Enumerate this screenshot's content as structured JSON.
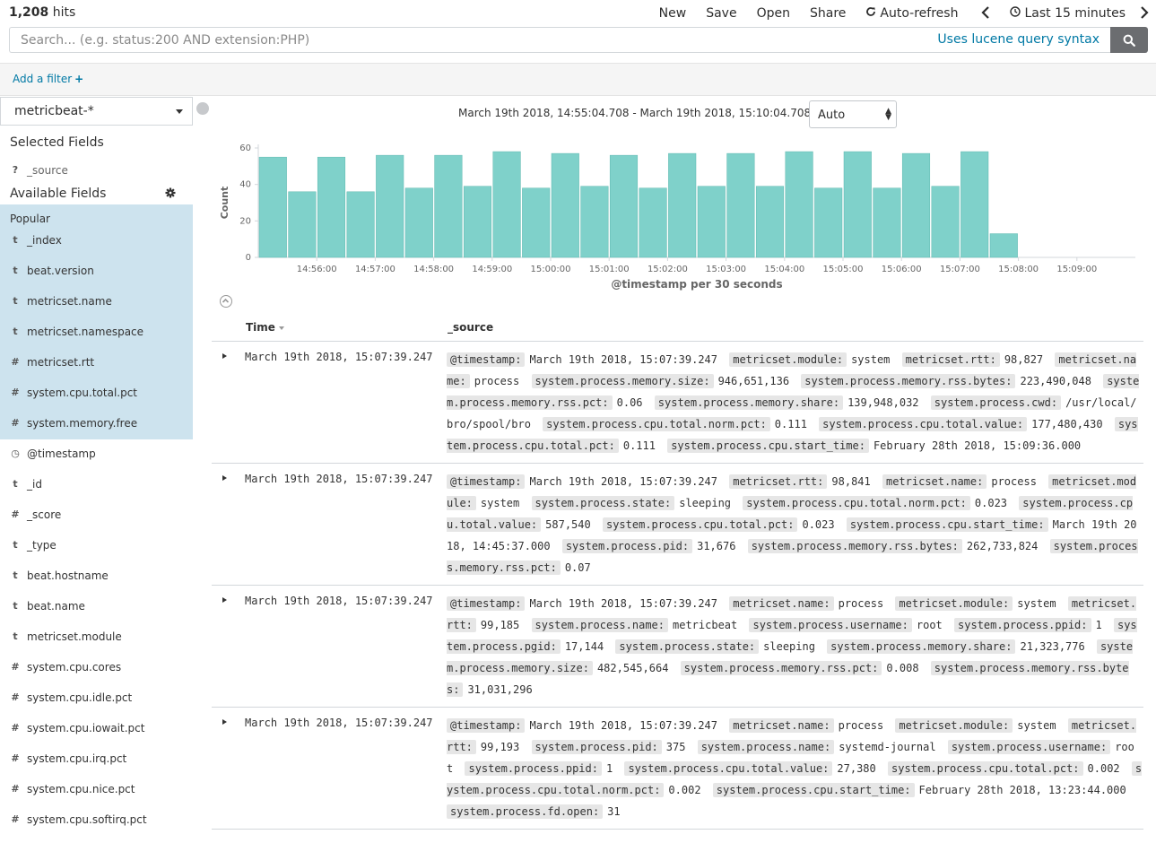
{
  "topbar": {
    "hits_count": "1,208",
    "hits_label": "hits",
    "nav": {
      "new": "New",
      "save": "Save",
      "open": "Open",
      "share": "Share",
      "auto_refresh": "Auto-refresh",
      "time_range": "Last 15 minutes"
    },
    "icons": {
      "auto_refresh": "refresh-icon",
      "time": "clock-icon",
      "prev": "chevron-left-icon",
      "next": "chevron-right-icon"
    }
  },
  "search": {
    "placeholder": "Search... (e.g. status:200 AND extension:PHP)",
    "syntax_link": "Uses lucene query syntax",
    "button_icon": "search-icon"
  },
  "filterbar": {
    "add_filter": "Add a filter",
    "add_filter_icon": "+"
  },
  "sidebar": {
    "index_pattern": "metricbeat-*",
    "selected_fields_title": "Selected Fields",
    "selected_fields": [
      {
        "type": "?",
        "name": "_source"
      }
    ],
    "available_fields_title": "Available Fields",
    "popular_label": "Popular",
    "popular_fields": [
      {
        "type": "t",
        "name": "_index"
      },
      {
        "type": "t",
        "name": "beat.version"
      },
      {
        "type": "t",
        "name": "metricset.name"
      },
      {
        "type": "t",
        "name": "metricset.namespace"
      },
      {
        "type": "#",
        "name": "metricset.rtt"
      },
      {
        "type": "#",
        "name": "system.cpu.total.pct"
      },
      {
        "type": "#",
        "name": "system.memory.free"
      }
    ],
    "other_fields": [
      {
        "type": "◷",
        "name": "@timestamp"
      },
      {
        "type": "t",
        "name": "_id"
      },
      {
        "type": "#",
        "name": "_score"
      },
      {
        "type": "t",
        "name": "_type"
      },
      {
        "type": "t",
        "name": "beat.hostname"
      },
      {
        "type": "t",
        "name": "beat.name"
      },
      {
        "type": "t",
        "name": "metricset.module"
      },
      {
        "type": "#",
        "name": "system.cpu.cores"
      },
      {
        "type": "#",
        "name": "system.cpu.idle.pct"
      },
      {
        "type": "#",
        "name": "system.cpu.iowait.pct"
      },
      {
        "type": "#",
        "name": "system.cpu.irq.pct"
      },
      {
        "type": "#",
        "name": "system.cpu.nice.pct"
      },
      {
        "type": "#",
        "name": "system.cpu.softirq.pct"
      }
    ]
  },
  "histogram": {
    "range_text": "March 19th 2018, 14:55:04.708 - March 19th 2018, 15:10:04.708 —",
    "interval": "Auto"
  },
  "chart_data": {
    "type": "bar",
    "ylabel": "Count",
    "xlabel": "@timestamp per 30 seconds",
    "ylim": [
      0,
      60
    ],
    "yticks": [
      0,
      20,
      40,
      60
    ],
    "grid": false,
    "x_start": "14:55:00",
    "bin_seconds": 30,
    "x_end": "15:10:00",
    "xtick_labels": [
      "14:56:00",
      "14:57:00",
      "14:58:00",
      "14:59:00",
      "15:00:00",
      "15:01:00",
      "15:02:00",
      "15:03:00",
      "15:04:00",
      "15:05:00",
      "15:06:00",
      "15:07:00",
      "15:08:00",
      "15:09:00"
    ],
    "values": [
      55,
      36,
      55,
      36,
      56,
      38,
      56,
      39,
      58,
      38,
      57,
      39,
      56,
      38,
      57,
      39,
      57,
      39,
      58,
      38,
      58,
      38,
      57,
      39,
      58,
      13
    ],
    "bar_color": "#7fd1ca"
  },
  "table": {
    "col_time": "Time",
    "col_source": "_source",
    "rows": [
      {
        "time": "March 19th 2018, 15:07:39.247",
        "fields": [
          [
            "@timestamp:",
            "March 19th 2018, 15:07:39.247"
          ],
          [
            "metricset.module:",
            "system"
          ],
          [
            "metricset.rtt:",
            "98,827"
          ],
          [
            "metricset.name:",
            "process"
          ],
          [
            "system.process.memory.size:",
            "946,651,136"
          ],
          [
            "system.process.memory.rss.bytes:",
            "223,490,048"
          ],
          [
            "system.process.memory.rss.pct:",
            "0.06"
          ],
          [
            "system.process.memory.share:",
            "139,948,032"
          ],
          [
            "system.process.cwd:",
            "/usr/local/bro/spool/bro"
          ],
          [
            "system.process.cpu.total.norm.pct:",
            "0.111"
          ],
          [
            "system.process.cpu.total.value:",
            "177,480,430"
          ],
          [
            "system.process.cpu.total.pct:",
            "0.111"
          ],
          [
            "system.process.cpu.start_time:",
            "February 28th 2018, 15:09:36.000"
          ]
        ]
      },
      {
        "time": "March 19th 2018, 15:07:39.247",
        "fields": [
          [
            "@timestamp:",
            "March 19th 2018, 15:07:39.247"
          ],
          [
            "metricset.rtt:",
            "98,841"
          ],
          [
            "metricset.name:",
            "process"
          ],
          [
            "metricset.module:",
            "system"
          ],
          [
            "system.process.state:",
            "sleeping"
          ],
          [
            "system.process.cpu.total.norm.pct:",
            "0.023"
          ],
          [
            "system.process.cpu.total.value:",
            "587,540"
          ],
          [
            "system.process.cpu.total.pct:",
            "0.023"
          ],
          [
            "system.process.cpu.start_time:",
            "March 19th 2018, 14:45:37.000"
          ],
          [
            "system.process.pid:",
            "31,676"
          ],
          [
            "system.process.memory.rss.bytes:",
            "262,733,824"
          ],
          [
            "system.process.memory.rss.pct:",
            "0.07"
          ]
        ]
      },
      {
        "time": "March 19th 2018, 15:07:39.247",
        "fields": [
          [
            "@timestamp:",
            "March 19th 2018, 15:07:39.247"
          ],
          [
            "metricset.name:",
            "process"
          ],
          [
            "metricset.module:",
            "system"
          ],
          [
            "metricset.rtt:",
            "99,185"
          ],
          [
            "system.process.name:",
            "metricbeat"
          ],
          [
            "system.process.username:",
            "root"
          ],
          [
            "system.process.ppid:",
            "1"
          ],
          [
            "system.process.pgid:",
            "17,144"
          ],
          [
            "system.process.state:",
            "sleeping"
          ],
          [
            "system.process.memory.share:",
            "21,323,776"
          ],
          [
            "system.process.memory.size:",
            "482,545,664"
          ],
          [
            "system.process.memory.rss.pct:",
            "0.008"
          ],
          [
            "system.process.memory.rss.bytes:",
            "31,031,296"
          ]
        ]
      },
      {
        "time": "March 19th 2018, 15:07:39.247",
        "fields": [
          [
            "@timestamp:",
            "March 19th 2018, 15:07:39.247"
          ],
          [
            "metricset.name:",
            "process"
          ],
          [
            "metricset.module:",
            "system"
          ],
          [
            "metricset.rtt:",
            "99,193"
          ],
          [
            "system.process.pid:",
            "375"
          ],
          [
            "system.process.name:",
            "systemd-journal"
          ],
          [
            "system.process.username:",
            "root"
          ],
          [
            "system.process.ppid:",
            "1"
          ],
          [
            "system.process.cpu.total.value:",
            "27,380"
          ],
          [
            "system.process.cpu.total.pct:",
            "0.002"
          ],
          [
            "system.process.cpu.total.norm.pct:",
            "0.002"
          ],
          [
            "system.process.cpu.start_time:",
            "February 28th 2018, 13:23:44.000"
          ],
          [
            "system.process.fd.open:",
            "31"
          ]
        ]
      }
    ]
  }
}
